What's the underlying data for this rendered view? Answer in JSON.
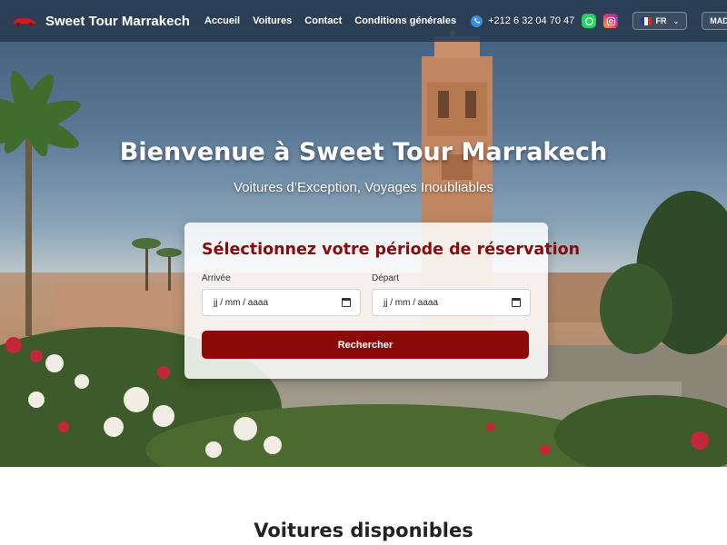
{
  "navbar": {
    "brand_name": "Sweet Tour Marrakech",
    "links": [
      {
        "label": "Accueil"
      },
      {
        "label": "Voitures"
      },
      {
        "label": "Contact"
      },
      {
        "label": "Conditions générales"
      }
    ],
    "phone": "+212 6 32 04 70 47",
    "language": "FR",
    "currency": "MAD"
  },
  "hero": {
    "title": "Bienvenue à Sweet Tour Marrakech",
    "subtitle": "Voitures d’Exception, Voyages Inoubliables"
  },
  "booking": {
    "title": "Sélectionnez votre période de réservation",
    "arrival_label": "Arrivée",
    "arrival_value": "jj / mm / aaaa",
    "departure_label": "Départ",
    "departure_value": "jj / mm / aaaa",
    "search_label": "Rechercher"
  },
  "cars_section": {
    "title": "Voitures disponibles"
  },
  "colors": {
    "brand_red": "#8b0b0b",
    "navbar_bg": "#283a50",
    "whatsapp": "#25d366",
    "phone_icon": "#3b8fd9"
  },
  "icons": {
    "logo": "red-car-logo",
    "phone": "phone-icon",
    "whatsapp": "whatsapp-icon",
    "instagram": "instagram-icon",
    "flag": "france-flag-icon",
    "calendar": "calendar-icon",
    "caret": "chevron-down-icon"
  }
}
